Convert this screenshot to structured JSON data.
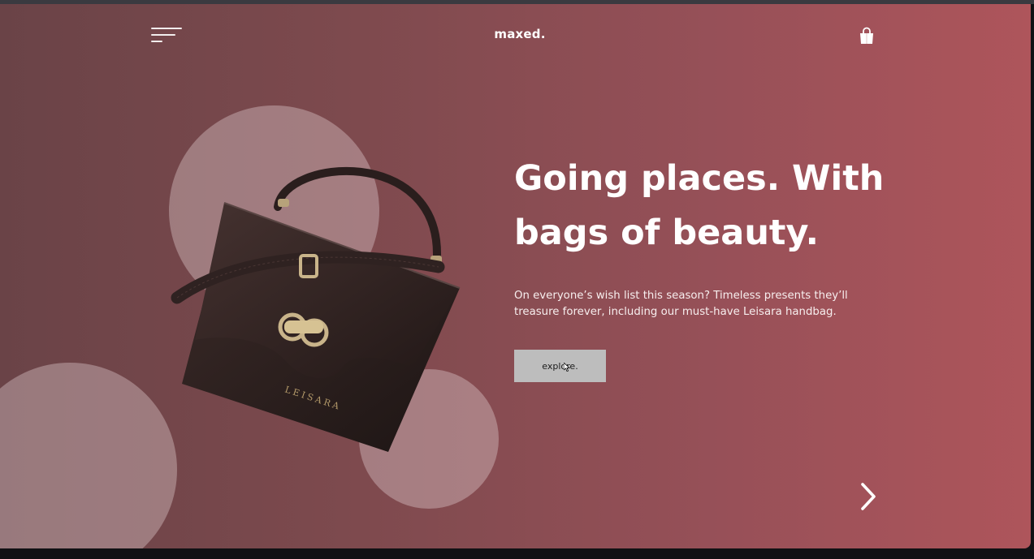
{
  "header": {
    "logo": "maxed."
  },
  "hero": {
    "headline": "Going places. With bags of beauty.",
    "description": "On everyone’s wish list this season? Timeless presents they’ll treasure forever, including our must-have Leisara handbag.",
    "cta_label": "explore.",
    "product_brand": "LEISARA"
  },
  "icons": {
    "menu": "hamburger-menu-icon",
    "cart": "shopping-bag-icon",
    "next": "chevron-right-icon"
  },
  "colors": {
    "gradient_left": "#6a4347",
    "gradient_right": "#ae555b",
    "circle_fill": "rgba(230,210,212,0.38)",
    "button_bg": "#bdbdbd",
    "text": "#ffffff"
  }
}
